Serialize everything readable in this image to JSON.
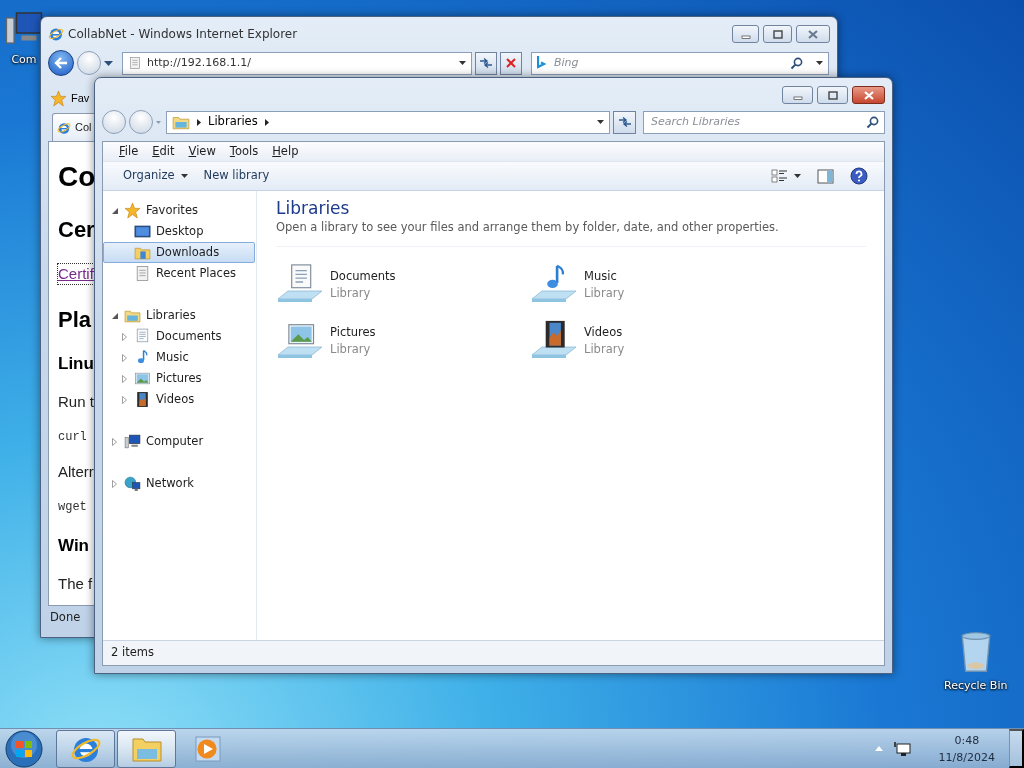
{
  "desktop_icons": [
    {
      "kind": "computer",
      "label": "Com"
    },
    {
      "kind": "recycle_bin",
      "label": "Recycle Bin"
    }
  ],
  "browser": {
    "title": "CollabNet - Windows Internet Explorer",
    "address": "http://192.168.1.1/",
    "search_placeholder": "Bing",
    "favorites_label": "Fav",
    "tab_label": "Col",
    "page": [
      {
        "kind": "h1",
        "text": "Co"
      },
      {
        "kind": "h2",
        "text": "Cer"
      },
      {
        "kind": "link",
        "text": "Certif"
      },
      {
        "kind": "h2",
        "text": "Pla"
      },
      {
        "kind": "h3",
        "text": "Linu"
      },
      {
        "kind": "p",
        "text": "Run t"
      },
      {
        "kind": "code",
        "text": "curl"
      },
      {
        "kind": "p",
        "text": "Alterr"
      },
      {
        "kind": "code",
        "text": "wget"
      },
      {
        "kind": "h3",
        "text": "Win"
      },
      {
        "kind": "p",
        "text": "The f"
      }
    ],
    "status": "Done"
  },
  "explorer": {
    "breadcrumb": [
      "Libraries"
    ],
    "search_placeholder": "Search Libraries",
    "menu": [
      "File",
      "Edit",
      "View",
      "Tools",
      "Help"
    ],
    "toolbar": [
      {
        "label": "Organize",
        "dropdown": true
      },
      {
        "label": "New library",
        "dropdown": false
      }
    ],
    "nav_tree": [
      {
        "kind": "star",
        "label": "Favorites",
        "expanded": true,
        "selected": false,
        "children": [
          {
            "kind": "desktop",
            "label": "Desktop",
            "selected": false
          },
          {
            "kind": "folder",
            "label": "Downloads",
            "selected": true
          },
          {
            "kind": "recent",
            "label": "Recent Places",
            "selected": false
          }
        ]
      },
      {
        "kind": "library",
        "label": "Libraries",
        "expanded": true,
        "selected": false,
        "children": [
          {
            "kind": "documents",
            "label": "Documents",
            "expanded": false,
            "selected": false
          },
          {
            "kind": "music",
            "label": "Music",
            "expanded": false,
            "selected": false
          },
          {
            "kind": "pictures",
            "label": "Pictures",
            "expanded": false,
            "selected": false
          },
          {
            "kind": "videos",
            "label": "Videos",
            "expanded": false,
            "selected": false
          }
        ]
      },
      {
        "kind": "computer",
        "label": "Computer",
        "expanded": false,
        "selected": false
      },
      {
        "kind": "network",
        "label": "Network",
        "expanded": false,
        "selected": false
      }
    ],
    "heading": "Libraries",
    "description": "Open a library to see your files and arrange them by folder, date, and other properties.",
    "items": [
      {
        "kind": "documents",
        "name": "Documents",
        "type": "Library"
      },
      {
        "kind": "music",
        "name": "Music",
        "type": "Library"
      },
      {
        "kind": "pictures",
        "name": "Pictures",
        "type": "Library"
      },
      {
        "kind": "videos",
        "name": "Videos",
        "type": "Library"
      }
    ],
    "status": "2 items"
  },
  "taskbar": {
    "buttons": [
      {
        "kind": "ie",
        "running": true,
        "selected": false
      },
      {
        "kind": "explorer",
        "running": true,
        "selected": true
      },
      {
        "kind": "media",
        "running": false,
        "selected": false
      }
    ],
    "time": "0:48",
    "date": "11/8/2024"
  }
}
